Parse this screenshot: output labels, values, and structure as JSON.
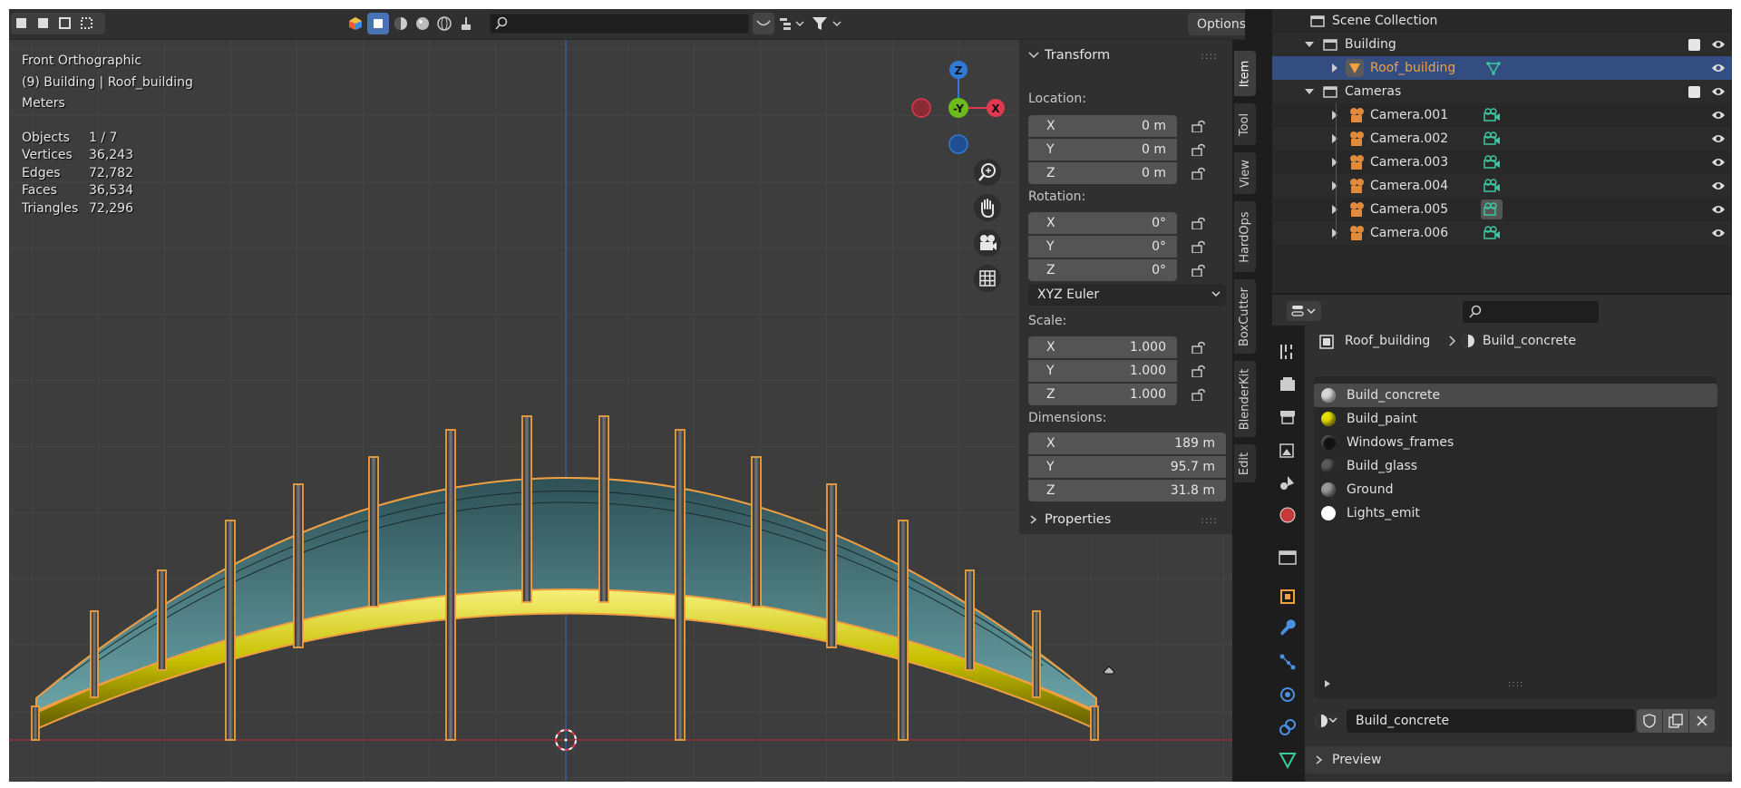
{
  "viewport": {
    "view_name": "Front Orthographic",
    "active_object": "(9) Building | Roof_building",
    "units": "Meters",
    "stats": [
      {
        "label": "Objects",
        "value": "1 / 7"
      },
      {
        "label": "Vertices",
        "value": "36,243"
      },
      {
        "label": "Edges",
        "value": "72,782"
      },
      {
        "label": "Faces",
        "value": "36,534"
      },
      {
        "label": "Triangles",
        "value": "72,296"
      }
    ],
    "options_label": "Options",
    "gizmo": {
      "z": "Z",
      "y": "-Y",
      "x": "X"
    }
  },
  "npanel": {
    "transform_title": "Transform",
    "location_label": "Location:",
    "location": [
      {
        "axis": "X",
        "value": "0 m"
      },
      {
        "axis": "Y",
        "value": "0 m"
      },
      {
        "axis": "Z",
        "value": "0 m"
      }
    ],
    "rotation_label": "Rotation:",
    "rotation": [
      {
        "axis": "X",
        "value": "0°"
      },
      {
        "axis": "Y",
        "value": "0°"
      },
      {
        "axis": "Z",
        "value": "0°"
      }
    ],
    "rotation_mode": "XYZ Euler",
    "scale_label": "Scale:",
    "scale": [
      {
        "axis": "X",
        "value": "1.000"
      },
      {
        "axis": "Y",
        "value": "1.000"
      },
      {
        "axis": "Z",
        "value": "1.000"
      }
    ],
    "dimensions_label": "Dimensions:",
    "dimensions": [
      {
        "axis": "X",
        "value": "189 m"
      },
      {
        "axis": "Y",
        "value": "95.7 m"
      },
      {
        "axis": "Z",
        "value": "31.8 m"
      }
    ],
    "properties_title": "Properties"
  },
  "side_tabs": [
    "Item",
    "Tool",
    "View",
    "HardOps",
    "BoxCutter",
    "BlenderKit",
    "Edit"
  ],
  "outliner": {
    "scene_collection": "Scene Collection",
    "building": "Building",
    "roof": "Roof_building",
    "cameras_collection": "Cameras",
    "cameras": [
      "Camera.001",
      "Camera.002",
      "Camera.003",
      "Camera.004",
      "Camera.005",
      "Camera.006"
    ]
  },
  "properties": {
    "breadcrumb_object": "Roof_building",
    "breadcrumb_material": "Build_concrete",
    "materials": [
      {
        "name": "Build_concrete",
        "color": "#d8d8d8"
      },
      {
        "name": "Build_paint",
        "color": "#e8e000"
      },
      {
        "name": "Windows_frames",
        "color": "#111111"
      },
      {
        "name": "Build_glass",
        "color": "#5a5a5a"
      },
      {
        "name": "Ground",
        "color": "#9a9a9a"
      },
      {
        "name": "Lights_emit",
        "color": "#ffffff"
      }
    ],
    "selected_material": "Build_concrete",
    "preview_label": "Preview"
  },
  "colors": {
    "accent_blue": "#4772b3",
    "selection_orange": "#f0a040",
    "axis_red": "#e0384f",
    "axis_green": "#6cbb1a",
    "axis_blue": "#2f7ad6"
  }
}
